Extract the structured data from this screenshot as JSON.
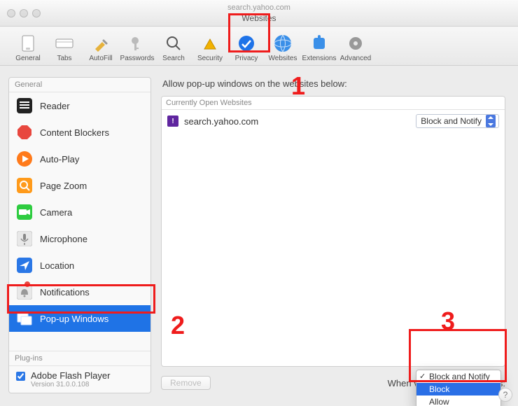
{
  "window": {
    "url_hint": "search.yahoo.com",
    "subtitle": "Websites"
  },
  "toolbar": [
    {
      "id": "general",
      "label": "General"
    },
    {
      "id": "tabs",
      "label": "Tabs"
    },
    {
      "id": "autofill",
      "label": "AutoFill"
    },
    {
      "id": "passwords",
      "label": "Passwords"
    },
    {
      "id": "search",
      "label": "Search"
    },
    {
      "id": "security",
      "label": "Security"
    },
    {
      "id": "privacy",
      "label": "Privacy"
    },
    {
      "id": "websites",
      "label": "Websites"
    },
    {
      "id": "extensions",
      "label": "Extensions"
    },
    {
      "id": "advanced",
      "label": "Advanced"
    }
  ],
  "sidebar": {
    "group1_label": "General",
    "items": [
      {
        "id": "reader",
        "label": "Reader"
      },
      {
        "id": "content-blockers",
        "label": "Content Blockers"
      },
      {
        "id": "auto-play",
        "label": "Auto-Play"
      },
      {
        "id": "page-zoom",
        "label": "Page Zoom"
      },
      {
        "id": "camera",
        "label": "Camera"
      },
      {
        "id": "microphone",
        "label": "Microphone"
      },
      {
        "id": "location",
        "label": "Location"
      },
      {
        "id": "notifications",
        "label": "Notifications"
      },
      {
        "id": "popup-windows",
        "label": "Pop-up Windows",
        "selected": true
      }
    ],
    "plugins_label": "Plug-ins",
    "plugin": {
      "enabled": true,
      "name": "Adobe Flash Player",
      "version": "Version 31.0.0.108"
    }
  },
  "content": {
    "heading": "Allow pop-up windows on the websites below:",
    "table_header": "Currently Open Websites",
    "rows": [
      {
        "site": "search.yahoo.com",
        "policy": "Block and Notify"
      }
    ],
    "remove_label": "Remove",
    "visit_label": "When visiting other websites:",
    "dropdown": {
      "options": [
        "Block and Notify",
        "Block",
        "Allow"
      ],
      "checked": "Block and Notify",
      "highlighted": "Block"
    }
  },
  "annotations": {
    "callouts": [
      "1",
      "2",
      "3"
    ]
  },
  "colors": {
    "annotation": "#ef1c1c",
    "selection": "#1f73e6",
    "accent": "#2a6fe6"
  }
}
